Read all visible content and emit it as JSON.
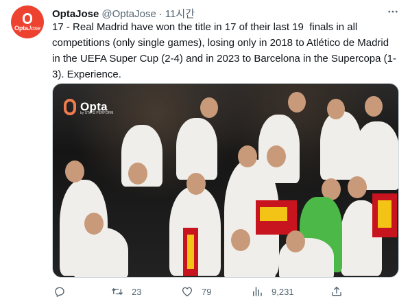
{
  "account": {
    "display_name": "OptaJose",
    "handle": "@OptaJose",
    "separator": "·",
    "time": "11시간",
    "avatar_text": "Opta",
    "avatar_text_italic": "Jose"
  },
  "tweet": {
    "text": "17 - Real Madrid have won the title in 17 of their last 19  finals in all competitions (only single games), losing only in 2018 to Atlético de Madrid in the UEFA Super Cup (2-4) and in 2023 to Barcelona in the Supercopa (1-3). Experience."
  },
  "media": {
    "watermark": "Opta",
    "watermark_sub": "by STATS PERFORM"
  },
  "actions": {
    "replies": "",
    "retweets": "23",
    "likes": "79",
    "views": "9,231"
  },
  "colors": {
    "avatar_bg": "#ee4230",
    "text_primary": "#0f1419",
    "text_secondary": "#536471",
    "border": "#cfd9de"
  },
  "icons": [
    "more-icon",
    "reply-icon",
    "retweet-icon",
    "like-icon",
    "views-icon",
    "share-icon"
  ]
}
